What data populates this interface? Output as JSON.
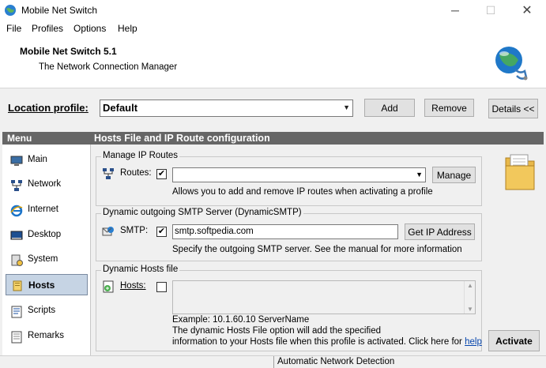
{
  "window": {
    "title": "Mobile Net Switch",
    "min": "─",
    "max": "☐",
    "close": "✕"
  },
  "menubar": {
    "file": "File",
    "profiles": "Profiles",
    "options": "Options",
    "help": "Help"
  },
  "header": {
    "title": "Mobile Net Switch 5.1",
    "subtitle": "The Network Connection Manager"
  },
  "location": {
    "label": "Location profile:",
    "value": "Default",
    "add": "Add",
    "remove": "Remove",
    "details": "Details <<"
  },
  "menu_header": "Menu",
  "section_header": "Hosts File and IP Route configuration",
  "sidebar": {
    "items": [
      {
        "label": "Main",
        "icon": "monitor-icon"
      },
      {
        "label": "Network",
        "icon": "network-icon"
      },
      {
        "label": "Internet",
        "icon": "internet-explorer-icon"
      },
      {
        "label": "Desktop",
        "icon": "desktop-icon"
      },
      {
        "label": "System",
        "icon": "system-icon"
      },
      {
        "label": "Hosts",
        "icon": "hosts-icon",
        "active": true
      },
      {
        "label": "Scripts",
        "icon": "scripts-icon"
      },
      {
        "label": "Remarks",
        "icon": "remarks-icon"
      }
    ]
  },
  "routes": {
    "group_title": "Manage IP Routes",
    "label": "Routes:",
    "checked": true,
    "value": "",
    "manage": "Manage",
    "desc": "Allows you to add and remove IP routes when activating a profile"
  },
  "smtp": {
    "group_title": "Dynamic outgoing SMTP Server (DynamicSMTP)",
    "label": "SMTP:",
    "checked": true,
    "value": "smtp.softpedia.com",
    "get_ip": "Get IP Address",
    "desc": "Specify the outgoing SMTP server. See the manual for more information"
  },
  "hosts": {
    "group_title": "Dynamic Hosts file",
    "label": "Hosts:",
    "checked": false,
    "example": "Example: 10.1.60.10  ServerName",
    "desc1": "The dynamic Hosts File option will add the specified",
    "desc2": "information to your Hosts file when this profile is activated. Click here for",
    "help": "help"
  },
  "activate": "Activate",
  "status": "Automatic Network Detection",
  "colors": {
    "header_bar": "#666666",
    "active_item": "#c6d4e4",
    "link": "#0645ad"
  }
}
